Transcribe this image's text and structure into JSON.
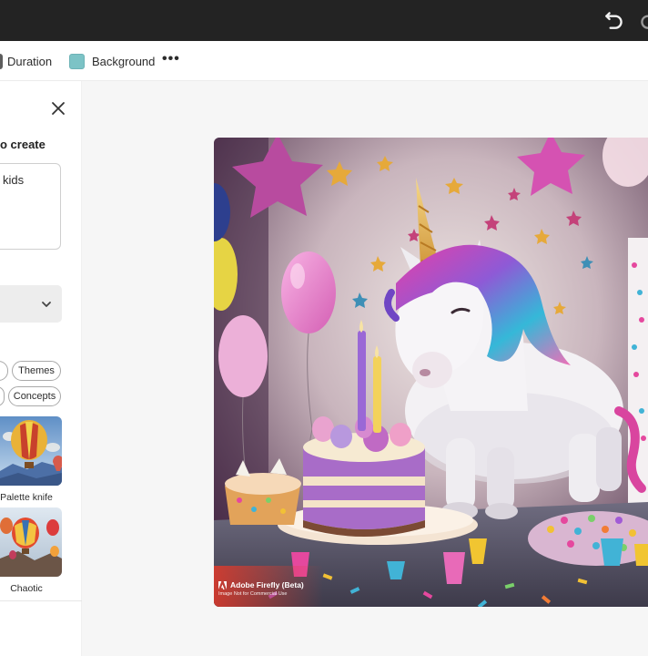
{
  "topbar": {
    "undo_icon": "undo-icon",
    "redo_icon": "redo-icon",
    "background_color": "#232323"
  },
  "toolbar": {
    "duration_label": "Duration",
    "background_label": "Background",
    "background_swatch_color": "#7cc3c6",
    "more_label": "•••"
  },
  "panel": {
    "close_icon": "close-icon",
    "create_label": "o create",
    "prompt_value": "kids",
    "select_chevron_icon": "chevron-down-icon",
    "chips": [
      {
        "label": "Themes"
      },
      {
        "label": "Concepts"
      }
    ],
    "styles": [
      {
        "label": "Palette knife"
      },
      {
        "label": "Chaotic"
      }
    ]
  },
  "canvas": {
    "image_subject": "unicorn birthday party with cake, candles, balloons and stars",
    "watermark_title": "Adobe Firefly (Beta)",
    "watermark_subtitle": "Image Not for Commercial Use"
  }
}
